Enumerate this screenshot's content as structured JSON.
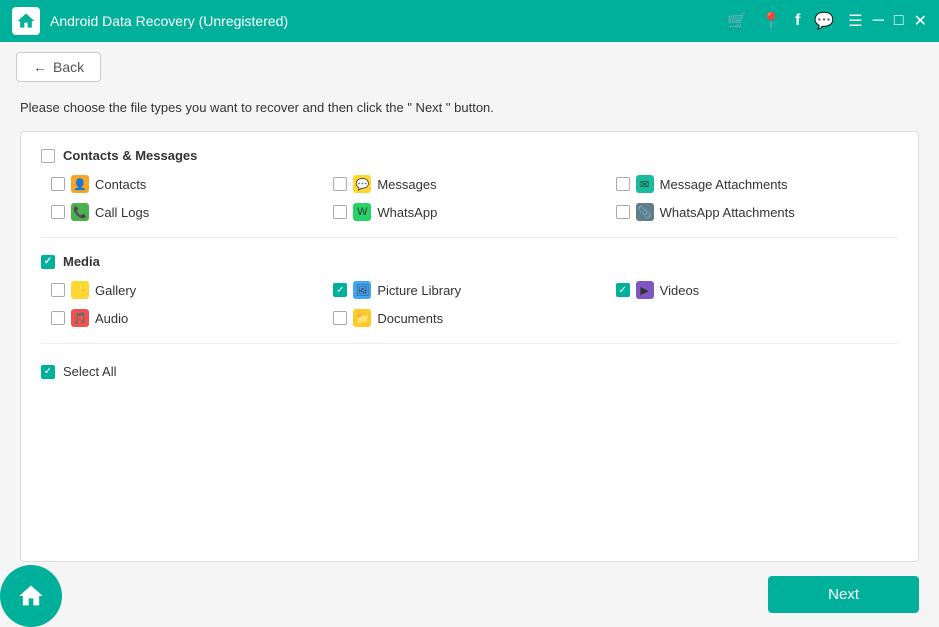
{
  "titlebar": {
    "title": "Android Data Recovery (Unregistered)",
    "icons": [
      "cart",
      "pin",
      "facebook",
      "chat",
      "menu"
    ],
    "win_controls": [
      "minimize",
      "maximize",
      "close"
    ]
  },
  "toolbar": {
    "back_label": "Back"
  },
  "instruction": "Please choose the file types you want to recover and then click the \" Next \" button.",
  "sections": [
    {
      "id": "contacts_messages",
      "label": "Contacts & Messages",
      "checked": false,
      "items": [
        {
          "label": "Contacts",
          "checked": false,
          "icon_color": "orange",
          "icon": "person"
        },
        {
          "label": "Messages",
          "checked": false,
          "icon_color": "green-chat",
          "icon": "msg"
        },
        {
          "label": "Message Attachments",
          "checked": false,
          "icon_color": "teal",
          "icon": "attach"
        },
        {
          "label": "Call Logs",
          "checked": false,
          "icon_color": "green-phone",
          "icon": "phone"
        },
        {
          "label": "WhatsApp",
          "checked": false,
          "icon_color": "green-chat",
          "icon": "wa"
        },
        {
          "label": "WhatsApp Attachments",
          "checked": false,
          "icon_color": "gray",
          "icon": "wa2"
        }
      ]
    },
    {
      "id": "media",
      "label": "Media",
      "checked": true,
      "items": [
        {
          "label": "Gallery",
          "checked": false,
          "icon_color": "yellow",
          "icon": "gallery"
        },
        {
          "label": "Picture Library",
          "checked": true,
          "icon_color": "blue",
          "icon": "picture"
        },
        {
          "label": "Videos",
          "checked": true,
          "icon_color": "purple",
          "icon": "video"
        },
        {
          "label": "Audio",
          "checked": false,
          "icon_color": "orange2",
          "icon": "audio"
        },
        {
          "label": "Documents",
          "checked": false,
          "icon_color": "folder",
          "icon": "docs"
        }
      ]
    }
  ],
  "select_all": {
    "label": "Select All",
    "checked": true
  },
  "next_button": "Next"
}
